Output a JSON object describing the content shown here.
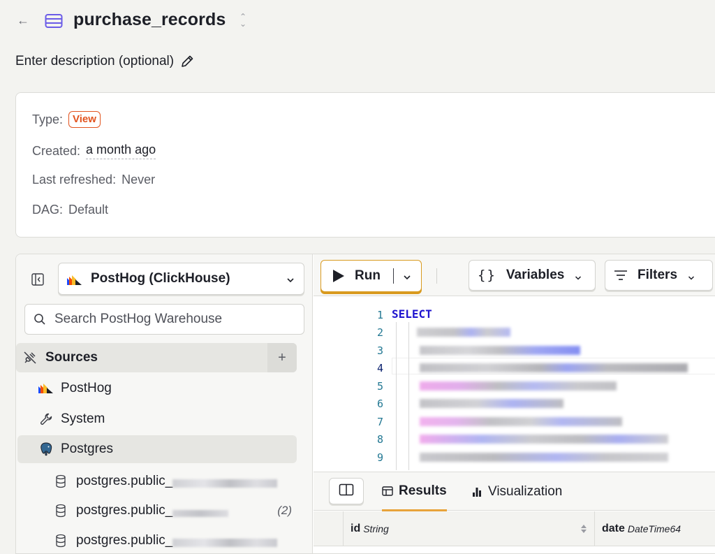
{
  "header": {
    "title": "purchase_records",
    "description_placeholder": "Enter description (optional)"
  },
  "info": {
    "type_label": "Type:",
    "type_value": "View",
    "created_label": "Created:",
    "created_value": "a month ago",
    "refreshed_label": "Last refreshed:",
    "refreshed_value": "Never",
    "dag_label": "DAG:",
    "dag_value": "Default"
  },
  "sidebar": {
    "source_select": "PostHog (ClickHouse)",
    "search_placeholder": "Search PostHog Warehouse",
    "sources_label": "Sources",
    "add_label": "+",
    "items": [
      {
        "label": "PostHog",
        "icon": "posthog-logo-icon"
      },
      {
        "label": "System",
        "icon": "wrench-icon"
      },
      {
        "label": "Postgres",
        "icon": "postgres-elephant-icon"
      }
    ],
    "tables": [
      {
        "label": "postgres.public_",
        "count": ""
      },
      {
        "label": "postgres.public_",
        "count": "(2)"
      },
      {
        "label": "postgres.public_",
        "count": ""
      }
    ]
  },
  "toolbar": {
    "run_label": "Run",
    "variables_glyph": "{}",
    "variables_label": "Variables",
    "filters_label": "Filters"
  },
  "editor": {
    "keyword": "SELECT",
    "line_numbers": [
      "1",
      "2",
      "3",
      "4",
      "5",
      "6",
      "7",
      "8",
      "9"
    ],
    "current_line": 4
  },
  "results": {
    "tabs": [
      {
        "label": "Results",
        "icon": "table-icon",
        "active": true
      },
      {
        "label": "Visualization",
        "icon": "bar-chart-icon",
        "active": false
      }
    ],
    "columns": [
      {
        "name": "id",
        "type": "String"
      },
      {
        "name": "date",
        "type": "DateTime64"
      }
    ]
  },
  "colors": {
    "accent": "#e8a33a",
    "badge": "#e2541f",
    "keyword": "#1f14cf"
  }
}
